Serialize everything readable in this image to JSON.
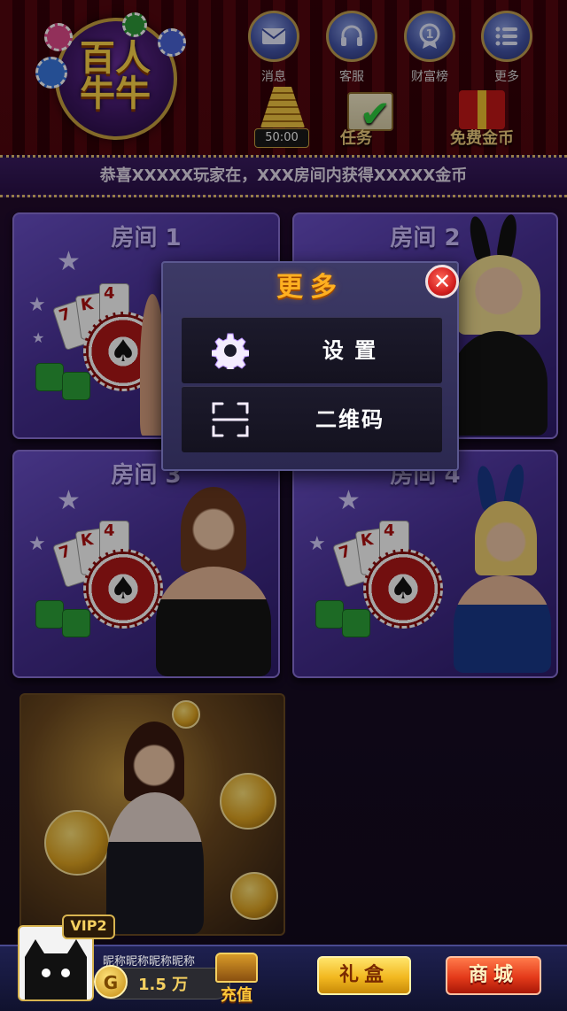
{
  "logo": {
    "line1": "百人",
    "line2": "牛牛"
  },
  "top_nav": [
    {
      "label": "消息",
      "icon": "envelope-icon"
    },
    {
      "label": "客服",
      "icon": "headset-icon"
    },
    {
      "label": "财富榜",
      "icon": "medal-icon"
    },
    {
      "label": "更多",
      "icon": "list-icon"
    }
  ],
  "shortcuts": {
    "timer": "50:00",
    "task_label": "任务",
    "free_coins_label": "免费金币"
  },
  "marquee": {
    "text": "恭喜XXXXX玩家在，XXX房间内获得XXXXX金币"
  },
  "rooms": [
    {
      "title": "房间 1"
    },
    {
      "title": "房间 2"
    },
    {
      "title": "房间 3"
    },
    {
      "title": "房间 4"
    }
  ],
  "modal": {
    "title": "更多",
    "items": [
      {
        "label": "设  置",
        "icon": "gear-icon"
      },
      {
        "label": "二维码",
        "icon": "qr-scan-icon"
      }
    ]
  },
  "player": {
    "vip": "VIP2",
    "nickname": "昵称昵称昵称昵称",
    "coin_symbol": "G",
    "coins": "1.5 万"
  },
  "bottom": {
    "charge_label": "充值",
    "gift_label": "礼盒",
    "shop_label": "商城"
  },
  "colors": {
    "accent_gold": "#ffb020",
    "room_purple": "#4a3298",
    "close_red": "#d42020"
  }
}
